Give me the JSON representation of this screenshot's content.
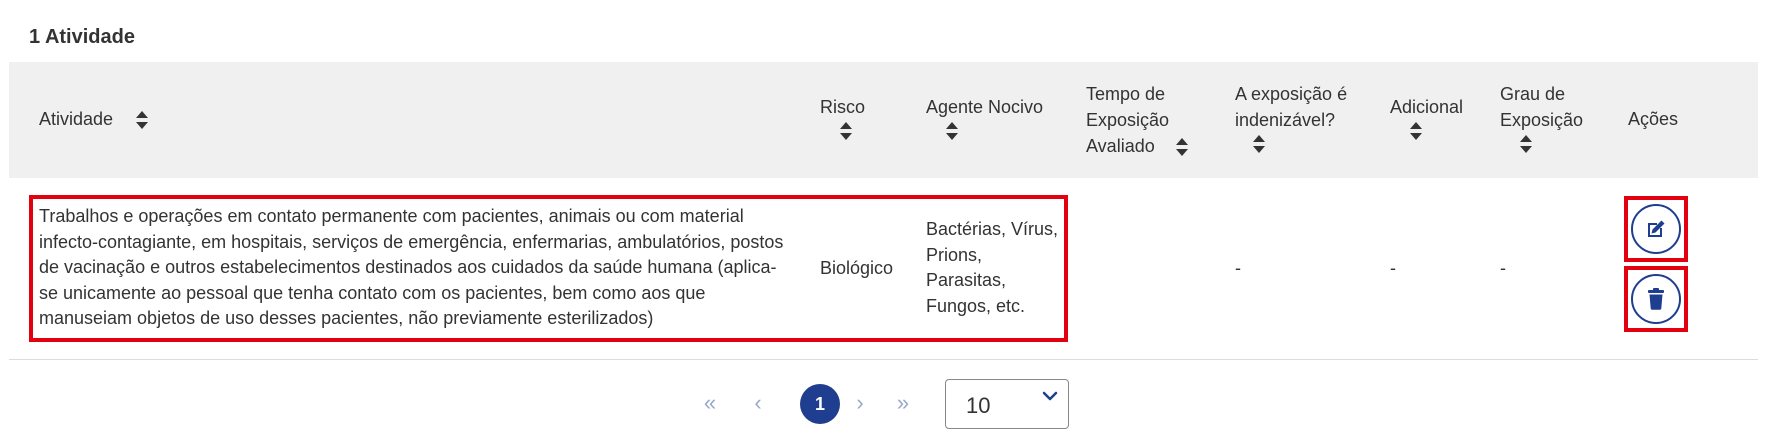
{
  "summary": {
    "count_label": "1 Atividade"
  },
  "table": {
    "headers": {
      "atividade": "Atividade",
      "risco": "Risco",
      "agente_nocivo": "Agente Nocivo",
      "tempo_l1": "Tempo de",
      "tempo_l2": "Exposição",
      "tempo_l3": "Avaliado",
      "indenizavel_l1": "A exposição é",
      "indenizavel_l2": "indenizável?",
      "adicional": "Adicional",
      "grau_l1": "Grau de",
      "grau_l2": "Exposição",
      "acoes": "Ações"
    },
    "rows": [
      {
        "atividade_lines": [
          "Trabalhos e operações em contato permanente com pacientes, animais ou com material",
          "infecto-contagiante, em hospitais, serviços de emergência, enfermarias, ambulatórios, postos",
          "de vacinação e outros estabelecimentos destinados aos cuidados da saúde humana (aplica-",
          "se unicamente ao pessoal que tenha contato com os pacientes, bem como aos que",
          "manuseiam objetos de uso desses pacientes, não previamente esterilizados)"
        ],
        "risco": "Biológico",
        "agente_lines": [
          "Bactérias, Vírus,",
          "Prions,",
          "Parasitas,",
          "Fungos, etc."
        ],
        "tempo": "",
        "indenizavel": "-",
        "adicional": "-",
        "grau": "-"
      }
    ]
  },
  "icons": {
    "edit": "edit-icon",
    "delete": "trash-icon"
  },
  "pagination": {
    "first": "«",
    "prev": "‹",
    "current_page": "1",
    "next": "›",
    "last": "»",
    "page_size": "10"
  },
  "colors": {
    "primary": "#1f3e8f",
    "highlight": "#e3000f",
    "header_bg": "#f0f0f0"
  }
}
